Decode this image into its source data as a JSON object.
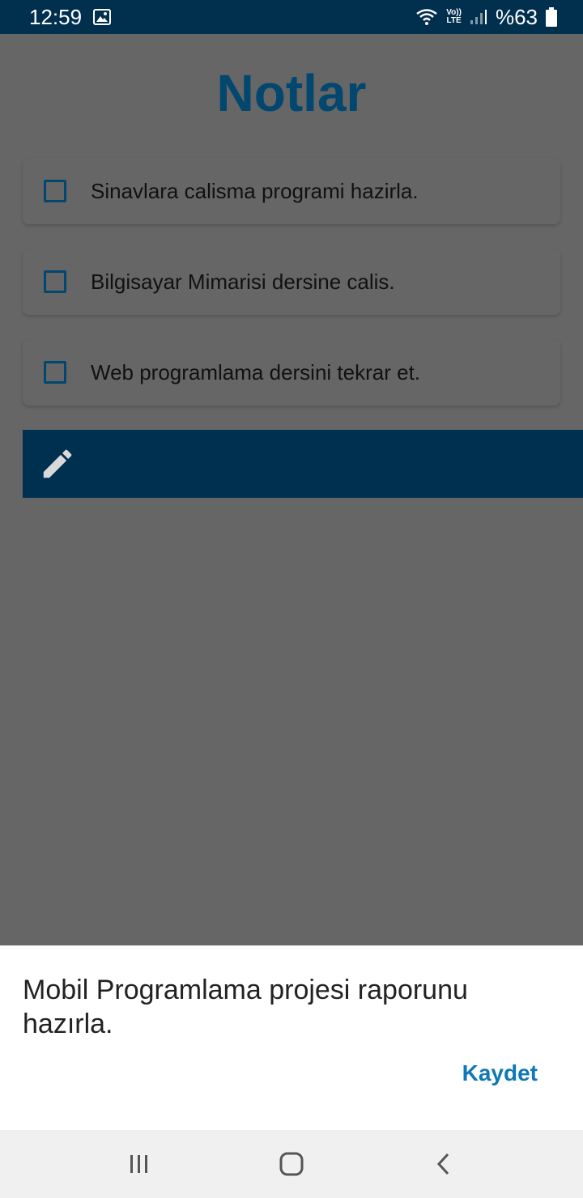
{
  "status_bar": {
    "time": "12:59",
    "battery": "%63",
    "icons": [
      "image-icon",
      "wifi-icon",
      "volte-icon",
      "signal-icon",
      "battery-icon"
    ],
    "volte_top": "Vo))",
    "volte_bottom": "LTE"
  },
  "app": {
    "title": "Notlar"
  },
  "todos": [
    {
      "text": "Sinavlara calisma programi hazirla.",
      "checked": false
    },
    {
      "text": "Bilgisayar Mimarisi dersine calis.",
      "checked": false
    },
    {
      "text": "Web programlama dersini tekrar et.",
      "checked": false
    }
  ],
  "input_bar": {
    "icon": "pencil-icon"
  },
  "sheet": {
    "text": "Mobil Programlama projesi raporunu hazırla.",
    "save_label": "Kaydet"
  },
  "nav": {
    "icons": [
      "recent-apps-icon",
      "home-icon",
      "back-icon"
    ]
  },
  "colors": {
    "status_bar": "#01304f",
    "title": "#02476f",
    "accent_button": "#0e78b6",
    "overlay_bg": "#666666"
  }
}
